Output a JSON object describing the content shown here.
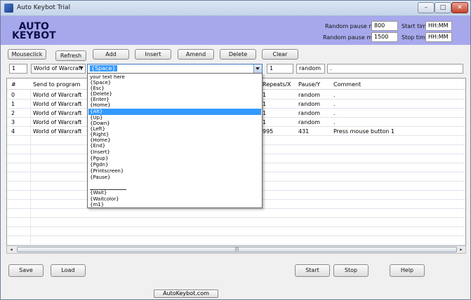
{
  "window": {
    "title": "Auto Keybot Trial"
  },
  "header": {
    "logo_line1": "AUTO",
    "logo_line2": "KEYBOT",
    "pause_min_label": "Random pause min",
    "pause_min_value": "800",
    "pause_max_label": "Random pause max",
    "pause_max_value": "1500",
    "start_time_label": "Start time",
    "start_time_value": "HH:MM",
    "stop_time_label": "Stop time",
    "stop_time_value": "HH:MM"
  },
  "toolbar": {
    "mouseclick": "Mouseclick",
    "refresh": "Refresh",
    "add": "Add",
    "insert": "Insert",
    "amend": "Amend",
    "delete": "Delete",
    "clear": "Clear"
  },
  "editor": {
    "index": "1",
    "program": "World of Warcraft",
    "command": "{Space}",
    "repeats": "1",
    "pause": "random",
    "comment": "."
  },
  "grid": {
    "columns": [
      "#",
      "Send to program",
      "Repeats/X",
      "Pause/Y",
      "Comment"
    ],
    "rows": [
      {
        "n": "0",
        "program": "World of Warcraft",
        "repeats": "1",
        "pause": "random",
        "comment": "."
      },
      {
        "n": "1",
        "program": "World of Warcraft",
        "repeats": "1",
        "pause": "random",
        "comment": "."
      },
      {
        "n": "2",
        "program": "World of Warcraft",
        "repeats": "1",
        "pause": "random",
        "comment": "."
      },
      {
        "n": "3",
        "program": "World of Warcraft",
        "repeats": "1",
        "pause": "random",
        "comment": "."
      },
      {
        "n": "4",
        "program": "World of Warcraft",
        "repeats": "995",
        "pause": "431",
        "comment": "Press mouse button 1"
      }
    ]
  },
  "dropdown": {
    "items": [
      "your text here",
      "{Space}",
      "{Esc}",
      "{Delete}",
      "{Enter}",
      "{Home}",
      "{Alt}",
      "{Up}",
      "{Down}",
      "{Left}",
      "{Right}",
      "{Home}",
      "{End}",
      "{Insert}",
      "{Pgup}",
      "{Pgdn}",
      "{Printscreen}",
      "{Pause}",
      "",
      "{Wait}",
      "{Waitcolor}",
      "{m1}"
    ],
    "active_index": 6
  },
  "bottom": {
    "save": "Save",
    "load": "Load",
    "start": "Start",
    "stop": "Stop",
    "help": "Help",
    "website": "AutoKeybot.com"
  },
  "colors": {
    "header_bg": "#a7a8ec",
    "selection": "#3399ff"
  }
}
